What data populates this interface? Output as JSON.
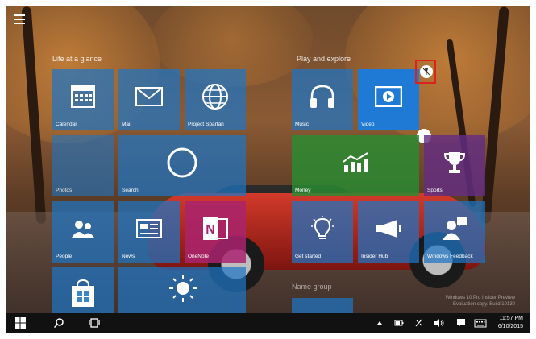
{
  "groups": [
    {
      "title": "Life at a glance"
    },
    {
      "title": "Play and explore"
    },
    {
      "title": "Name group"
    }
  ],
  "tiles": {
    "calendar": {
      "label": "Calendar"
    },
    "mail": {
      "label": "Mail"
    },
    "edge": {
      "label": "Project Spartan"
    },
    "photos": {
      "label": "Photos"
    },
    "search": {
      "label": "Search"
    },
    "people": {
      "label": "People"
    },
    "news": {
      "label": "News"
    },
    "onenote": {
      "label": "OneNote"
    },
    "store": {
      "label": ""
    },
    "weather": {
      "label": ""
    },
    "music": {
      "label": "Music"
    },
    "video": {
      "label": "Video"
    },
    "money": {
      "label": "Money"
    },
    "sports": {
      "label": "Sports"
    },
    "getstarted": {
      "label": "Get started"
    },
    "insiderhub": {
      "label": "Insider Hub"
    },
    "feedback": {
      "label": "Windows Feedback"
    },
    "newgroup": {
      "label": ""
    }
  },
  "watermark": {
    "line1": "Windows 10 Pro Insider Preview",
    "line2": "Evaluation copy. Build 10130"
  },
  "taskbar": {
    "time": "11:57 PM",
    "date": "6/10/2015"
  },
  "icons": {
    "start": "windows-logo-icon",
    "search": "search-icon",
    "taskview": "task-view-icon",
    "unpin": "unpin-icon",
    "more": "more-options-icon"
  },
  "colors": {
    "tile_blue": "#1f74c4",
    "tile_selected": "#1f7ad6",
    "tile_green": "#288c32",
    "tile_purple": "#642d82",
    "tile_onenote": "#aa236e",
    "highlight": "#e0201c",
    "taskbar": "#111111"
  }
}
